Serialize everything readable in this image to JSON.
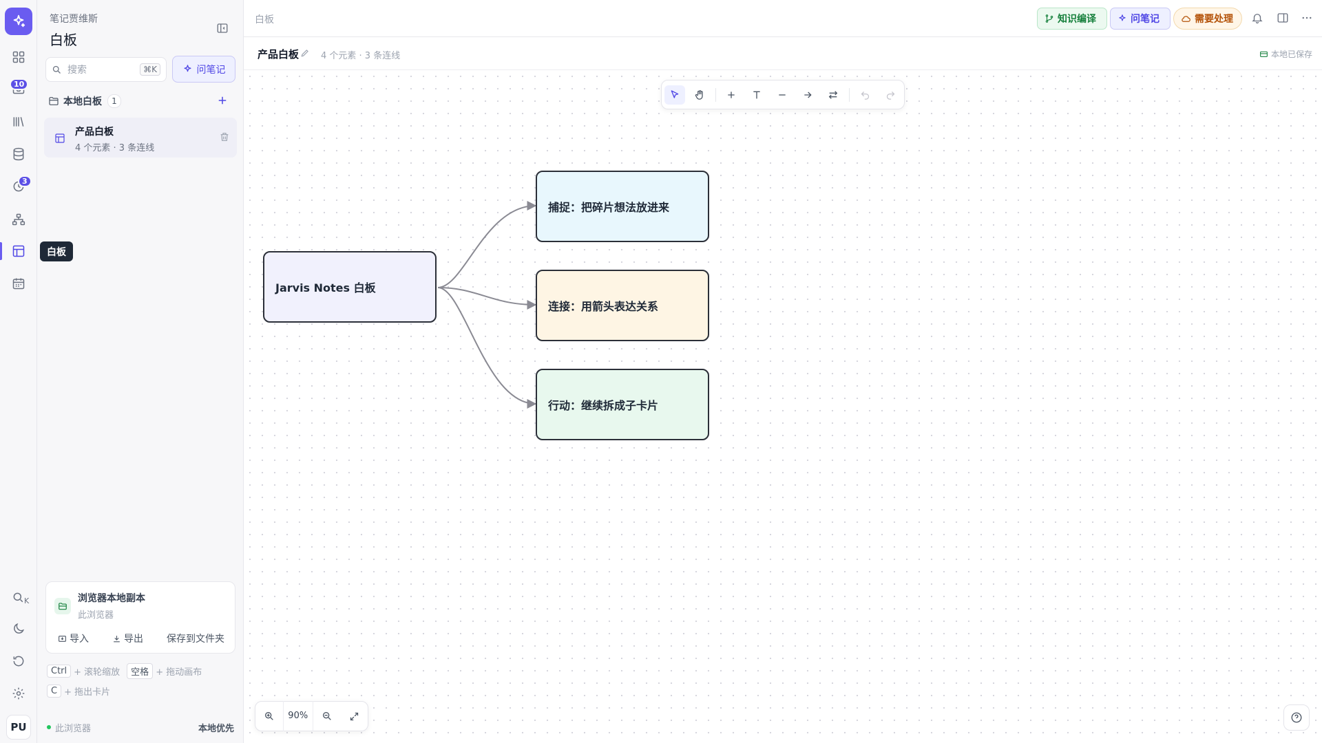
{
  "rail": {
    "badges": {
      "inbox": "10",
      "review": "3"
    },
    "tooltip": "白板",
    "avatar": "PU",
    "search_shortcut_suffix": "K"
  },
  "sidebar": {
    "workspace_label": "笔记贾维斯",
    "title": "白板",
    "search": {
      "placeholder": "搜索",
      "shortcut": "⌘K"
    },
    "ask_button": "问笔记",
    "folder": {
      "label": "本地白板",
      "count": "1"
    },
    "boards": [
      {
        "title": "产品白板",
        "meta": "4 个元素 · 3 条连线"
      }
    ],
    "storage": {
      "title": "浏览器本地副本",
      "subtitle": "此浏览器",
      "import": "导入",
      "export": "导出",
      "save_to_folder": "保存到文件夹"
    },
    "hints": {
      "ctrl_key": "Ctrl",
      "ctrl_text": "+ 滚轮缩放",
      "space_key": "空格",
      "space_text": "+ 拖动画布",
      "c_key": "C",
      "c_text": "+ 拖出卡片"
    },
    "status": {
      "left": "此浏览器",
      "right": "本地优先"
    }
  },
  "topbar": {
    "breadcrumb": "白板",
    "knowledge_compile": "知识编译",
    "ask_notes": "问笔记",
    "needs_attention": "需要处理"
  },
  "subbar": {
    "doc_title": "产品白板",
    "doc_meta": "4 个元素 · 3 条连线",
    "saved_status": "本地已保存"
  },
  "whiteboard": {
    "nodes": [
      {
        "id": "root",
        "label": "Jarvis Notes 白板",
        "fill": "#f1f1fd"
      },
      {
        "id": "capture",
        "label": "捕捉：把碎片想法放进来",
        "fill": "#e8f7fd"
      },
      {
        "id": "connect",
        "label": "连接：用箭头表达关系",
        "fill": "#fef5e4"
      },
      {
        "id": "action",
        "label": "行动：继续拆成子卡片",
        "fill": "#e8f8ee"
      }
    ],
    "edges": [
      {
        "from": "root",
        "to": "capture"
      },
      {
        "from": "root",
        "to": "connect"
      },
      {
        "from": "root",
        "to": "action"
      }
    ],
    "zoom": "90%"
  },
  "colors": {
    "accent": "#6a5cf0",
    "edge": "#8a8a93",
    "node_border": "#2b2f38"
  }
}
